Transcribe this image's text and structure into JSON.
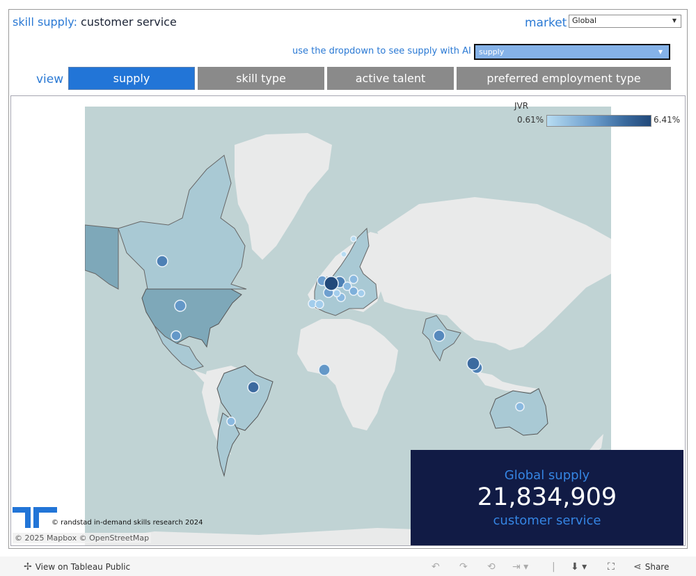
{
  "header": {
    "title_lead": "skill supply:",
    "title_topic": "customer service",
    "market_label": "market",
    "market_value": "Global",
    "ai_prompt": "use the dropdown to see supply with AI",
    "ai_value": "supply"
  },
  "view": {
    "label": "view",
    "tabs": [
      {
        "label": "supply",
        "active": true
      },
      {
        "label": "skill type",
        "active": false
      },
      {
        "label": "active talent",
        "active": false
      },
      {
        "label": "preferred employment type",
        "active": false
      }
    ]
  },
  "legend": {
    "title": "JVR",
    "min": "0.61%",
    "max": "6.41%",
    "colors": [
      "#b7dcf2",
      "#22497a"
    ]
  },
  "map": {
    "points": [
      {
        "market": "Canada",
        "size": "medium",
        "jvr_level": 0.7
      },
      {
        "market": "United States",
        "size": "medium",
        "jvr_level": 0.55
      },
      {
        "market": "Mexico",
        "size": "small",
        "jvr_level": 0.5
      },
      {
        "market": "Brazil",
        "size": "medium",
        "jvr_level": 0.8
      },
      {
        "market": "Argentina",
        "size": "small",
        "jvr_level": 0.25
      },
      {
        "market": "Nigeria / West Africa",
        "size": "medium",
        "jvr_level": 0.55
      },
      {
        "market": "India",
        "size": "medium",
        "jvr_level": 0.6
      },
      {
        "market": "Singapore",
        "size": "large",
        "jvr_level": 0.75
      },
      {
        "market": "Malaysia",
        "size": "medium",
        "jvr_level": 0.65
      },
      {
        "market": "Australia",
        "size": "small",
        "jvr_level": 0.3
      },
      {
        "market": "Germany",
        "size": "xlarge",
        "jvr_level": 1.0
      },
      {
        "market": "Netherlands / Belgium",
        "size": "large",
        "jvr_level": 0.75
      },
      {
        "market": "United Kingdom",
        "size": "medium",
        "jvr_level": 0.5
      },
      {
        "market": "France",
        "size": "medium",
        "jvr_level": 0.45
      },
      {
        "market": "Switzerland",
        "size": "small",
        "jvr_level": 0.25
      },
      {
        "market": "Italy",
        "size": "medium",
        "jvr_level": 0.35
      },
      {
        "market": "Poland",
        "size": "medium",
        "jvr_level": 0.3
      },
      {
        "market": "Austria",
        "size": "medium",
        "jvr_level": 0.35
      },
      {
        "market": "Hungary",
        "size": "medium",
        "jvr_level": 0.35
      },
      {
        "market": "Romania",
        "size": "small",
        "jvr_level": 0.2
      },
      {
        "market": "Spain",
        "size": "small",
        "jvr_level": 0.25
      },
      {
        "market": "Portugal",
        "size": "small",
        "jvr_level": 0.2
      },
      {
        "market": "Sweden",
        "size": "small",
        "jvr_level": 0.15
      },
      {
        "market": "Norway",
        "size": "small",
        "jvr_level": 0.1
      }
    ]
  },
  "kpi": {
    "label": "Global supply",
    "value": "21,834,909",
    "sub": "customer service"
  },
  "credits": {
    "research": "© randstad in-demand skills research 2024",
    "attribution": "© 2025 Mapbox © OpenStreetMap"
  },
  "footer": {
    "view_on": "View on Tableau Public",
    "share": "Share"
  }
}
